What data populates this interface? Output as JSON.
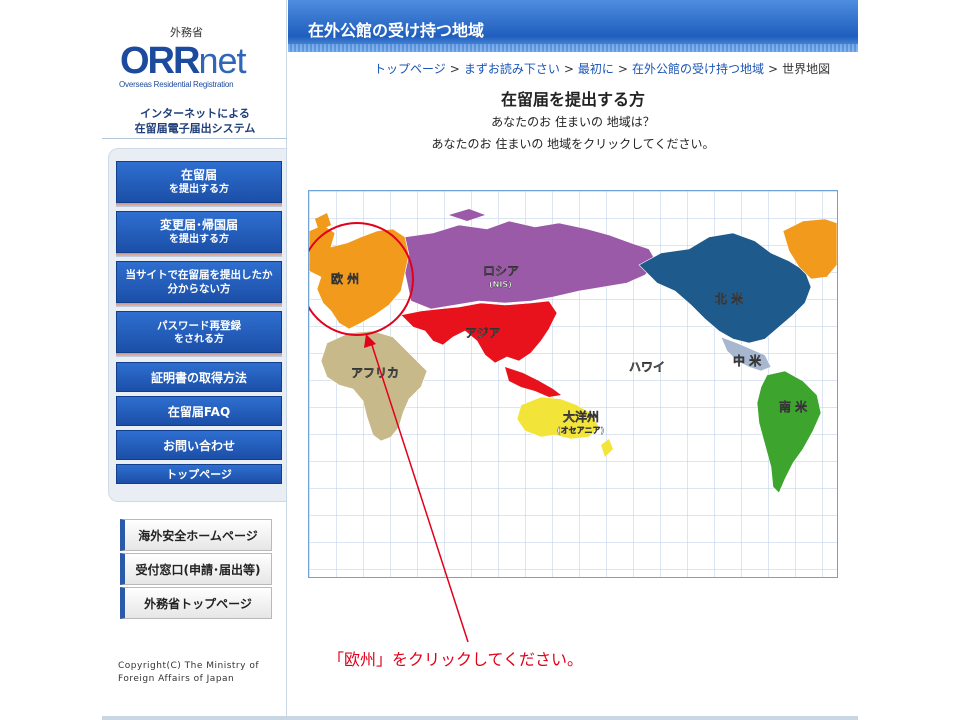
{
  "sidebar": {
    "ministry": "外務省",
    "logo_main": "ORR",
    "logo_net": "net",
    "logo_sub": "Overseas Residential Registration",
    "tagline_1": "インターネットによる",
    "tagline_2": "在留届電子届出システム",
    "menu": [
      {
        "l1": "在留届",
        "l2": "を提出する方"
      },
      {
        "l1": "変更届･帰国届",
        "l2": "を提出する方"
      },
      {
        "l1": "当サイトで在留届を提出したか",
        "l2": "分からない方"
      },
      {
        "l1": "パスワード再登録",
        "l2": "をされる方"
      },
      {
        "l1": "証明書の取得方法"
      },
      {
        "l1": "在留届FAQ"
      },
      {
        "l1": "お問い合わせ"
      },
      {
        "l1": "トップページ"
      }
    ],
    "external": [
      "海外安全ホームページ",
      "受付窓口(申請･届出等)",
      "外務省トップページ"
    ],
    "copyright_1": "Copyright(C) The Ministry of",
    "copyright_2": "Foreign Affairs of Japan"
  },
  "header": {
    "title": "在外公館の受け持つ地域"
  },
  "breadcrumb": {
    "items": [
      "トップページ",
      "まずお読み下さい",
      "最初に",
      "在外公館の受け持つ地域"
    ],
    "current": "世界地図",
    "separator": ">"
  },
  "main": {
    "title": "在留届を提出する方",
    "question": "あなたのお 住まいの 地域は？",
    "prompt": "あなたのお 住まいの 地域をクリックしてください。"
  },
  "map": {
    "regions": {
      "europe": "欧 州",
      "russia": "ロシア",
      "russia_sub": "(NIS)",
      "asia": "アジア",
      "africa": "アフリカ",
      "hawaii": "ハワイ",
      "north_america": "北 米",
      "central_america": "中 米",
      "south_america": "南 米",
      "oceania": "大洋州",
      "oceania_sub": "(オセアニア)"
    },
    "colors": {
      "europe": "#f29a1c",
      "russia": "#9a5aa8",
      "asia": "#e8121c",
      "asia_se": "#e8121c",
      "africa": "#c8b98a",
      "north_america": "#1e5a8c",
      "greenland": "#f29a1c",
      "central_america": "#a6b7cf",
      "south_america": "#3da52e",
      "oceania": "#f3e43a",
      "highlight": "#e2001a",
      "grid": "#b8cde6"
    }
  },
  "annotation": {
    "instruction": "「欧州」をクリックしてください。"
  }
}
